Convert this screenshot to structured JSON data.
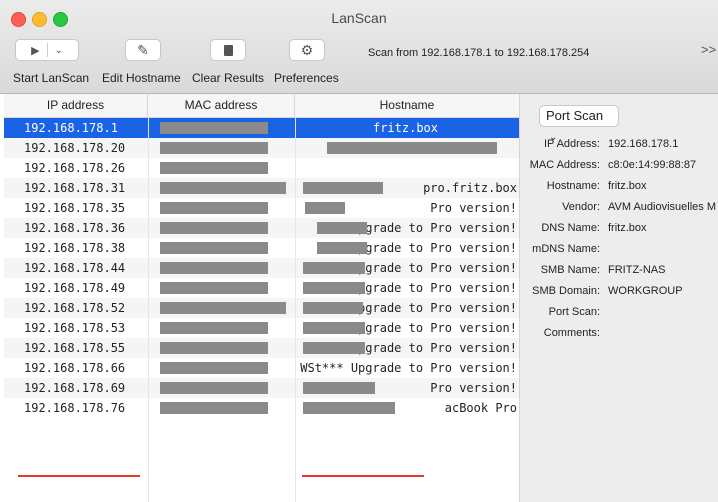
{
  "window": {
    "title": "LanScan"
  },
  "toolbar": {
    "start_label": "Start LanScan",
    "edit_label": "Edit Hostname",
    "clear_label": "Clear Results",
    "prefs_label": "Preferences",
    "scan_range": "Scan from 192.168.178.1 to 192.168.178.254",
    "overflow": ">>"
  },
  "table": {
    "headers": [
      "IP address",
      "MAC address",
      "Hostname"
    ],
    "rows": [
      {
        "ip": "192.168.178.1",
        "host": "fritz.box"
      },
      {
        "ip": "192.168.178.20",
        "host": ""
      },
      {
        "ip": "192.168.178.26",
        "host": ""
      },
      {
        "ip": "192.168.178.31",
        "host": "pro.fritz.box"
      },
      {
        "ip": "192.168.178.35",
        "host": "Pro version!"
      },
      {
        "ip": "192.168.178.36",
        "host": "Upgrade to Pro version!"
      },
      {
        "ip": "192.168.178.38",
        "host": "Upgrade to Pro version!"
      },
      {
        "ip": "192.168.178.44",
        "host": "pgrade to Pro version!"
      },
      {
        "ip": "192.168.178.49",
        "host": "Upgrade to Pro version!"
      },
      {
        "ip": "192.168.178.52",
        "host": "Upgrade to Pro version!"
      },
      {
        "ip": "192.168.178.53",
        "host": "Upgrade to Pro version!"
      },
      {
        "ip": "192.168.178.55",
        "host": "pgrade to Pro version!"
      },
      {
        "ip": "192.168.178.66",
        "host": "WSt*** Upgrade to Pro version!"
      },
      {
        "ip": "192.168.178.69",
        "host": "Pro version!"
      },
      {
        "ip": "192.168.178.76",
        "host": "acBook Pro"
      }
    ]
  },
  "details": {
    "port_scan_label": "Port Scan",
    "labels": [
      "IP Address:",
      "MAC Address:",
      "Hostname:",
      "Vendor:",
      "DNS Name:",
      "mDNS Name:",
      "SMB Name:",
      "SMB Domain:",
      "Port Scan:",
      "Comments:"
    ],
    "values": [
      "192.168.178.1",
      "c8:0e:14:99:88:87",
      "fritz.box",
      "AVM Audiovisuelles M",
      "fritz.box",
      "",
      "FRITZ-NAS",
      "WORKGROUP",
      "",
      ""
    ]
  },
  "colors": {
    "selection": "#1a63e6",
    "annotation": "#e53a2e"
  }
}
